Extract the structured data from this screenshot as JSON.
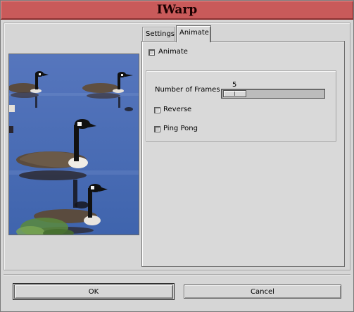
{
  "window": {
    "title": "IWarp"
  },
  "tabs": [
    {
      "label": "Settings",
      "selected": false
    },
    {
      "label": "Animate",
      "selected": true
    }
  ],
  "animate_panel": {
    "animate_checkbox": {
      "label": "Animate",
      "checked": true
    },
    "frames": {
      "label": "Number of Frames",
      "value": "5"
    },
    "reverse_checkbox": {
      "label": "Reverse",
      "checked": false
    },
    "pingpong_checkbox": {
      "label": "Ping Pong",
      "checked": true
    }
  },
  "buttons": {
    "ok": "OK",
    "cancel": "Cancel"
  },
  "preview": {
    "subject": "canada geese on water"
  }
}
